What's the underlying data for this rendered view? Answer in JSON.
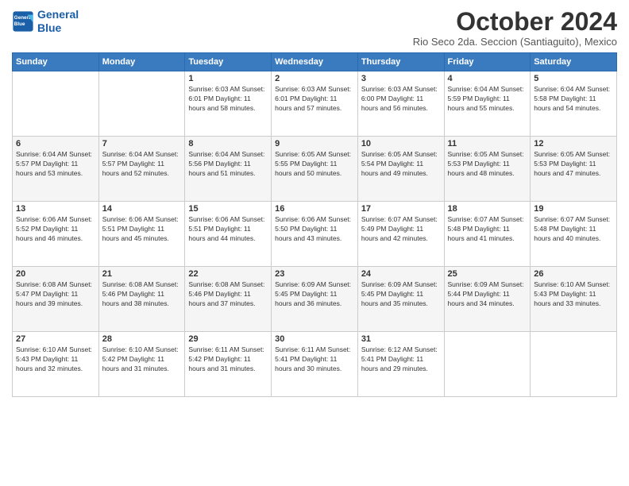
{
  "logo": {
    "line1": "General",
    "line2": "Blue"
  },
  "header": {
    "month": "October 2024",
    "subtitle": "Rio Seco 2da. Seccion (Santiaguito), Mexico"
  },
  "weekdays": [
    "Sunday",
    "Monday",
    "Tuesday",
    "Wednesday",
    "Thursday",
    "Friday",
    "Saturday"
  ],
  "weeks": [
    [
      {
        "day": "",
        "info": ""
      },
      {
        "day": "",
        "info": ""
      },
      {
        "day": "1",
        "info": "Sunrise: 6:03 AM\nSunset: 6:01 PM\nDaylight: 11 hours and 58 minutes."
      },
      {
        "day": "2",
        "info": "Sunrise: 6:03 AM\nSunset: 6:01 PM\nDaylight: 11 hours and 57 minutes."
      },
      {
        "day": "3",
        "info": "Sunrise: 6:03 AM\nSunset: 6:00 PM\nDaylight: 11 hours and 56 minutes."
      },
      {
        "day": "4",
        "info": "Sunrise: 6:04 AM\nSunset: 5:59 PM\nDaylight: 11 hours and 55 minutes."
      },
      {
        "day": "5",
        "info": "Sunrise: 6:04 AM\nSunset: 5:58 PM\nDaylight: 11 hours and 54 minutes."
      }
    ],
    [
      {
        "day": "6",
        "info": "Sunrise: 6:04 AM\nSunset: 5:57 PM\nDaylight: 11 hours and 53 minutes."
      },
      {
        "day": "7",
        "info": "Sunrise: 6:04 AM\nSunset: 5:57 PM\nDaylight: 11 hours and 52 minutes."
      },
      {
        "day": "8",
        "info": "Sunrise: 6:04 AM\nSunset: 5:56 PM\nDaylight: 11 hours and 51 minutes."
      },
      {
        "day": "9",
        "info": "Sunrise: 6:05 AM\nSunset: 5:55 PM\nDaylight: 11 hours and 50 minutes."
      },
      {
        "day": "10",
        "info": "Sunrise: 6:05 AM\nSunset: 5:54 PM\nDaylight: 11 hours and 49 minutes."
      },
      {
        "day": "11",
        "info": "Sunrise: 6:05 AM\nSunset: 5:53 PM\nDaylight: 11 hours and 48 minutes."
      },
      {
        "day": "12",
        "info": "Sunrise: 6:05 AM\nSunset: 5:53 PM\nDaylight: 11 hours and 47 minutes."
      }
    ],
    [
      {
        "day": "13",
        "info": "Sunrise: 6:06 AM\nSunset: 5:52 PM\nDaylight: 11 hours and 46 minutes."
      },
      {
        "day": "14",
        "info": "Sunrise: 6:06 AM\nSunset: 5:51 PM\nDaylight: 11 hours and 45 minutes."
      },
      {
        "day": "15",
        "info": "Sunrise: 6:06 AM\nSunset: 5:51 PM\nDaylight: 11 hours and 44 minutes."
      },
      {
        "day": "16",
        "info": "Sunrise: 6:06 AM\nSunset: 5:50 PM\nDaylight: 11 hours and 43 minutes."
      },
      {
        "day": "17",
        "info": "Sunrise: 6:07 AM\nSunset: 5:49 PM\nDaylight: 11 hours and 42 minutes."
      },
      {
        "day": "18",
        "info": "Sunrise: 6:07 AM\nSunset: 5:48 PM\nDaylight: 11 hours and 41 minutes."
      },
      {
        "day": "19",
        "info": "Sunrise: 6:07 AM\nSunset: 5:48 PM\nDaylight: 11 hours and 40 minutes."
      }
    ],
    [
      {
        "day": "20",
        "info": "Sunrise: 6:08 AM\nSunset: 5:47 PM\nDaylight: 11 hours and 39 minutes."
      },
      {
        "day": "21",
        "info": "Sunrise: 6:08 AM\nSunset: 5:46 PM\nDaylight: 11 hours and 38 minutes."
      },
      {
        "day": "22",
        "info": "Sunrise: 6:08 AM\nSunset: 5:46 PM\nDaylight: 11 hours and 37 minutes."
      },
      {
        "day": "23",
        "info": "Sunrise: 6:09 AM\nSunset: 5:45 PM\nDaylight: 11 hours and 36 minutes."
      },
      {
        "day": "24",
        "info": "Sunrise: 6:09 AM\nSunset: 5:45 PM\nDaylight: 11 hours and 35 minutes."
      },
      {
        "day": "25",
        "info": "Sunrise: 6:09 AM\nSunset: 5:44 PM\nDaylight: 11 hours and 34 minutes."
      },
      {
        "day": "26",
        "info": "Sunrise: 6:10 AM\nSunset: 5:43 PM\nDaylight: 11 hours and 33 minutes."
      }
    ],
    [
      {
        "day": "27",
        "info": "Sunrise: 6:10 AM\nSunset: 5:43 PM\nDaylight: 11 hours and 32 minutes."
      },
      {
        "day": "28",
        "info": "Sunrise: 6:10 AM\nSunset: 5:42 PM\nDaylight: 11 hours and 31 minutes."
      },
      {
        "day": "29",
        "info": "Sunrise: 6:11 AM\nSunset: 5:42 PM\nDaylight: 11 hours and 31 minutes."
      },
      {
        "day": "30",
        "info": "Sunrise: 6:11 AM\nSunset: 5:41 PM\nDaylight: 11 hours and 30 minutes."
      },
      {
        "day": "31",
        "info": "Sunrise: 6:12 AM\nSunset: 5:41 PM\nDaylight: 11 hours and 29 minutes."
      },
      {
        "day": "",
        "info": ""
      },
      {
        "day": "",
        "info": ""
      }
    ]
  ]
}
